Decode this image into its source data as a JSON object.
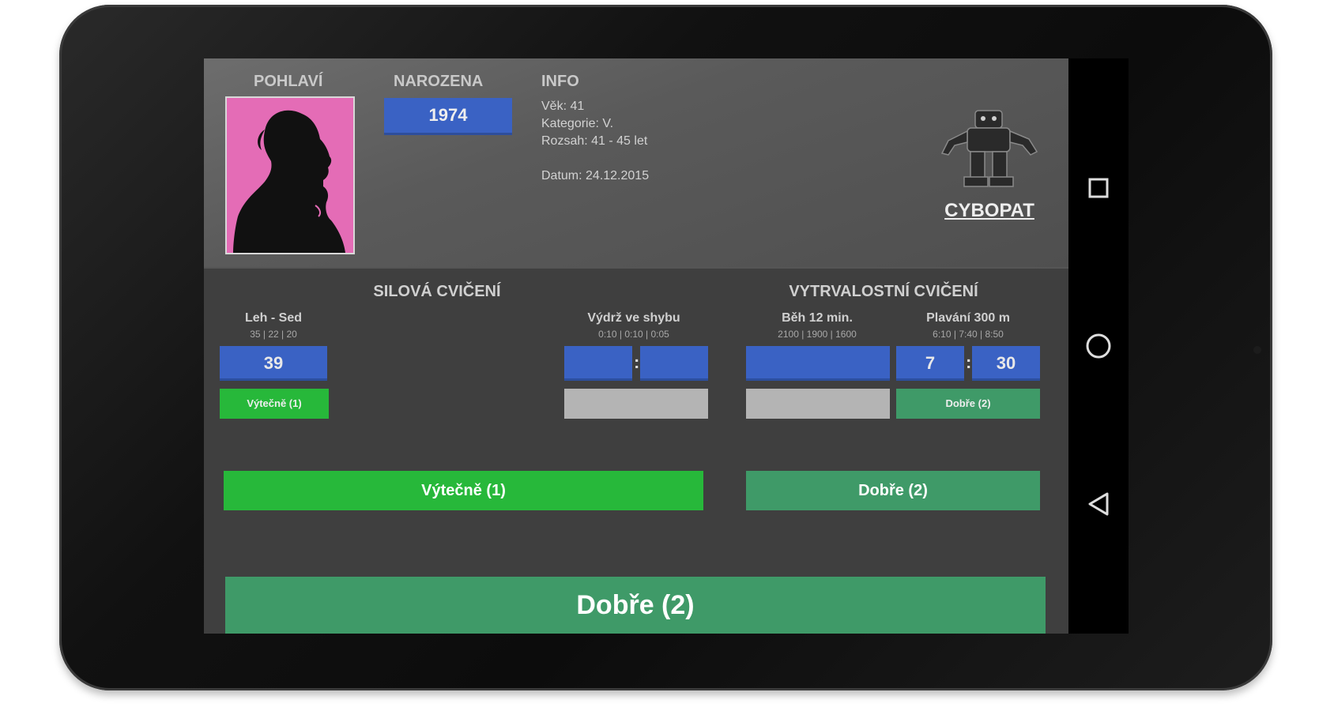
{
  "header": {
    "gender_label": "POHLAVÍ",
    "born_label": "NAROZENA",
    "born_value": "1974",
    "info_label": "INFO",
    "info_age": "Věk: 41",
    "info_category": "Kategorie: V.",
    "info_range": "Rozsah: 41 - 45 let",
    "info_date": "Datum: 24.12.2015",
    "logo_text": "CYBOPAT"
  },
  "strength": {
    "title": "SILOVÁ CVIČENÍ",
    "situps": {
      "name": "Leh - Sed",
      "limits": "35 | 22 | 20",
      "value": "39",
      "result": "Výtečně (1)"
    },
    "hang": {
      "name": "Výdrž ve shybu",
      "limits": "0:10 | 0:10 | 0:05",
      "minutes": "",
      "seconds": "",
      "separator": ":",
      "result": ""
    },
    "total": "Výtečně (1)"
  },
  "endurance": {
    "title": "VYTRVALOSTNÍ CVIČENÍ",
    "run": {
      "name": "Běh 12 min.",
      "limits": "2100 | 1900 | 1600",
      "value": "",
      "result": ""
    },
    "swim": {
      "name": "Plavání 300 m",
      "limits": "6:10 | 7:40 | 8:50",
      "minutes": "7",
      "seconds": "30",
      "separator": ":",
      "result": "Dobře (2)"
    },
    "total": "Dobře (2)"
  },
  "overall": "Dobře (2)",
  "colors": {
    "blue": "#3a62c4",
    "green": "#27b83a",
    "teal": "#3f9a68",
    "pink": "#e46cb6"
  },
  "icons": [
    "recents-icon",
    "home-icon",
    "back-icon"
  ]
}
